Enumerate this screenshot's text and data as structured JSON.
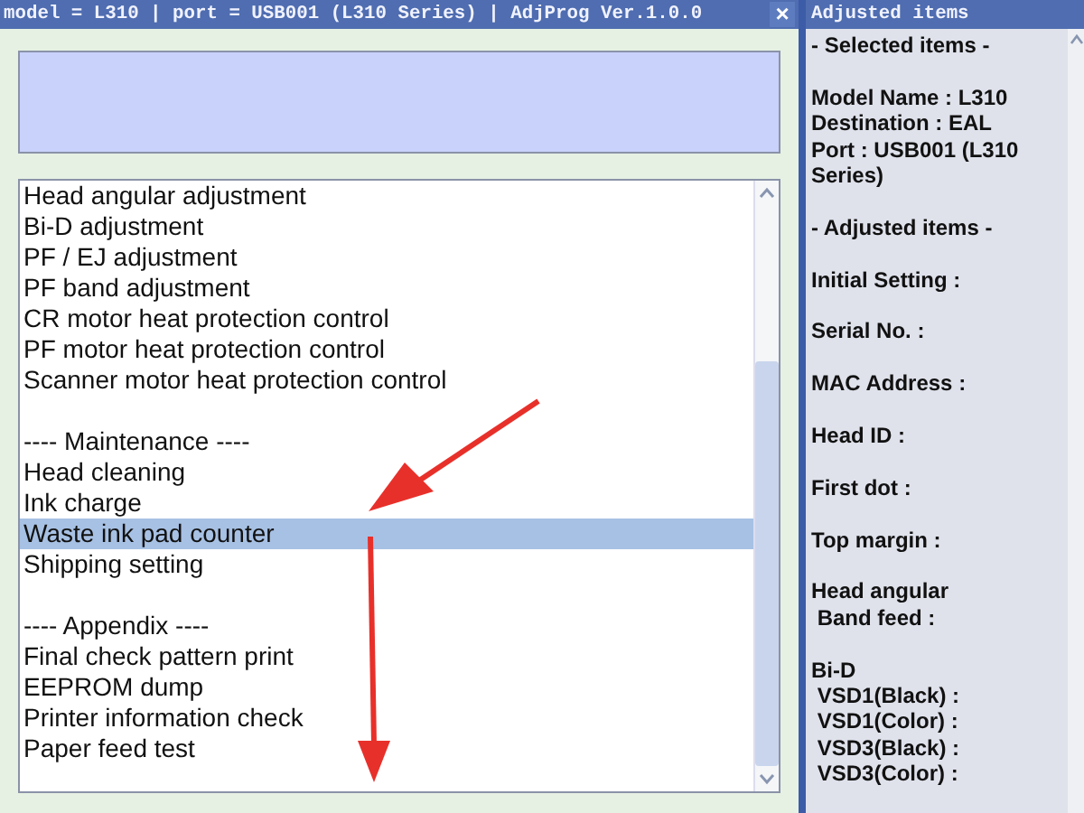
{
  "main_window": {
    "title": "model = L310 | port = USB001 (L310 Series) | AdjProg Ver.1.0.0",
    "close": "×"
  },
  "items": [
    {
      "kind": "item",
      "text": "Head angular adjustment",
      "selected": false
    },
    {
      "kind": "item",
      "text": "Bi-D adjustment",
      "selected": false
    },
    {
      "kind": "item",
      "text": "PF / EJ adjustment",
      "selected": false
    },
    {
      "kind": "item",
      "text": "PF band adjustment",
      "selected": false
    },
    {
      "kind": "item",
      "text": "CR motor heat protection control",
      "selected": false
    },
    {
      "kind": "item",
      "text": "PF motor heat protection control",
      "selected": false
    },
    {
      "kind": "item",
      "text": "Scanner motor heat protection control",
      "selected": false
    },
    {
      "kind": "blank"
    },
    {
      "kind": "header",
      "text": "---- Maintenance ----",
      "selected": false
    },
    {
      "kind": "item",
      "text": "Head cleaning",
      "selected": false
    },
    {
      "kind": "item",
      "text": "Ink charge",
      "selected": false
    },
    {
      "kind": "item",
      "text": "Waste ink pad counter",
      "selected": true
    },
    {
      "kind": "item",
      "text": "Shipping setting",
      "selected": false
    },
    {
      "kind": "blank"
    },
    {
      "kind": "header",
      "text": "---- Appendix ----",
      "selected": false
    },
    {
      "kind": "item",
      "text": "Final check pattern print",
      "selected": false
    },
    {
      "kind": "item",
      "text": "EEPROM dump",
      "selected": false
    },
    {
      "kind": "item",
      "text": "Printer information check",
      "selected": false
    },
    {
      "kind": "item",
      "text": "Paper feed test",
      "selected": false
    }
  ],
  "side_panel": {
    "title": "Adjusted items",
    "groups": [
      [
        "- Selected items -"
      ],
      [
        "Model Name : L310",
        "Destination : EAL",
        "Port : USB001 (L310 Series)"
      ],
      [
        "- Adjusted items -"
      ],
      [
        "Initial Setting :"
      ],
      [
        "Serial No. :"
      ],
      [
        "MAC Address :"
      ],
      [
        "Head ID :"
      ],
      [
        "First dot :"
      ],
      [
        "Top margin :"
      ],
      [
        "Head angular",
        " Band feed :"
      ],
      [
        "Bi-D",
        " VSD1(Black) :",
        " VSD1(Color) :",
        " VSD3(Black) :",
        " VSD3(Color) :"
      ]
    ]
  }
}
